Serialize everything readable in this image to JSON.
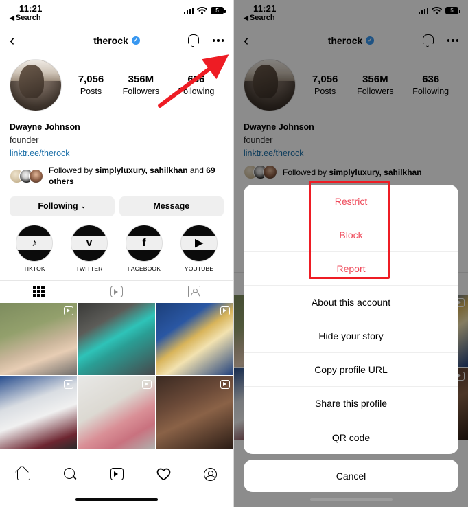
{
  "meta": {
    "accent_red": "#ee1c24",
    "danger_red": "#ef4b5b",
    "link_blue": "#1b6fa8",
    "verified_blue": "#3797f0"
  },
  "status_bar": {
    "time": "11:21",
    "back_label": "Search",
    "back_triangle": "◀",
    "cellular_icon": "cellular-bars-icon",
    "wifi_icon": "wifi-icon",
    "battery_icon": "battery-icon",
    "battery_text": "5"
  },
  "nav_bar": {
    "back_icon": "‹",
    "username": "therock",
    "verified_glyph": "✓",
    "bell_icon": "bell-icon",
    "more_icon": "more-options-icon"
  },
  "profile": {
    "avatar_alt": "profile-photo",
    "stats": [
      {
        "value": "7,056",
        "label": "Posts"
      },
      {
        "value": "356M",
        "label": "Followers"
      },
      {
        "value": "636",
        "label": "Following"
      }
    ],
    "name": "Dwayne Johnson",
    "category": "founder",
    "link": "linktr.ee/therock",
    "followed_by_prefix": "Followed by ",
    "followed_by_names": "simplyluxury, sahilkhan",
    "followed_by_mid": " and ",
    "followed_by_count": "69 others"
  },
  "actions": {
    "following_label": "Following",
    "following_chevron": "⌄",
    "message_label": "Message"
  },
  "highlights": [
    {
      "label": "TIKTOK",
      "glyph": "♪",
      "icon": "tiktok-icon"
    },
    {
      "label": "TWITTER",
      "glyph": "ᴠ",
      "icon": "twitter-icon"
    },
    {
      "label": "FACEBOOK",
      "glyph": "f",
      "icon": "facebook-icon"
    },
    {
      "label": "YOUTUBE",
      "glyph": "▶",
      "icon": "youtube-icon"
    }
  ],
  "tabs": [
    {
      "name": "grid-tab",
      "active": true
    },
    {
      "name": "reels-tab",
      "active": false
    },
    {
      "name": "tagged-tab",
      "active": false
    }
  ],
  "posts": [
    {
      "id": "post-1",
      "is_reel": true
    },
    {
      "id": "post-2",
      "is_reel": false
    },
    {
      "id": "post-3",
      "is_reel": true
    },
    {
      "id": "post-4",
      "is_reel": true
    },
    {
      "id": "post-5",
      "is_reel": true
    },
    {
      "id": "post-6",
      "is_reel": true
    }
  ],
  "bottom_nav": [
    {
      "name": "home-icon",
      "label": "Home"
    },
    {
      "name": "search-icon",
      "label": "Search"
    },
    {
      "name": "reels-icon",
      "label": "Reels"
    },
    {
      "name": "heart-icon",
      "label": "Activity"
    },
    {
      "name": "profile-icon",
      "label": "Profile"
    }
  ],
  "action_sheet": {
    "items": [
      {
        "label": "Restrict",
        "danger": true
      },
      {
        "label": "Block",
        "danger": true
      },
      {
        "label": "Report",
        "danger": true
      },
      {
        "label": "About this account",
        "danger": false
      },
      {
        "label": "Hide your story",
        "danger": false
      },
      {
        "label": "Copy profile URL",
        "danger": false
      },
      {
        "label": "Share this profile",
        "danger": false
      },
      {
        "label": "QR code",
        "danger": false
      }
    ],
    "cancel_label": "Cancel"
  },
  "annotations": {
    "arrow_target": "more-options-icon",
    "highlight_box_target": "restrict-block-report-group"
  }
}
